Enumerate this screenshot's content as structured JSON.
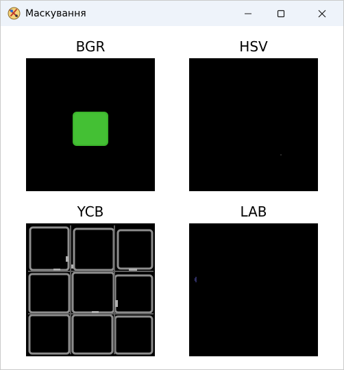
{
  "window": {
    "title": "Маскування"
  },
  "panels": [
    {
      "label": "BGR"
    },
    {
      "label": "HSV"
    },
    {
      "label": "YCB"
    },
    {
      "label": "LAB"
    }
  ],
  "colors": {
    "titlebar": "#eef3fa",
    "mask_background": "#000000",
    "bgr_square": "#3cb42c",
    "ycb_outline": "#9a9a9a"
  }
}
